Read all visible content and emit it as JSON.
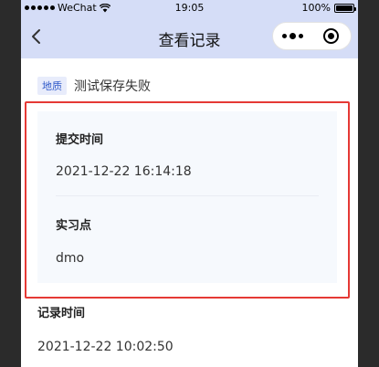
{
  "status_bar": {
    "carrier": "WeChat",
    "time": "19:05",
    "battery": "100%",
    "battery_level": 1.0
  },
  "nav": {
    "title": "查看记录",
    "back_icon": "chevron-left-icon",
    "more_icon": "more-dots-icon",
    "close_icon": "target-close-icon"
  },
  "record": {
    "tag": "地质",
    "title": "测试保存失败"
  },
  "card": {
    "submit_time_label": "提交时间",
    "submit_time_value": "2021-12-22 16:14:18",
    "internship_label": "实习点",
    "internship_value": "dmo"
  },
  "record_time": {
    "label": "记录时间",
    "value": "2021-12-22 10:02:50"
  },
  "colors": {
    "header_bg": "#d5ddf7",
    "tag_text": "#2f59c9",
    "highlight_border": "#e53935",
    "card_bg": "#f6f9fd"
  }
}
